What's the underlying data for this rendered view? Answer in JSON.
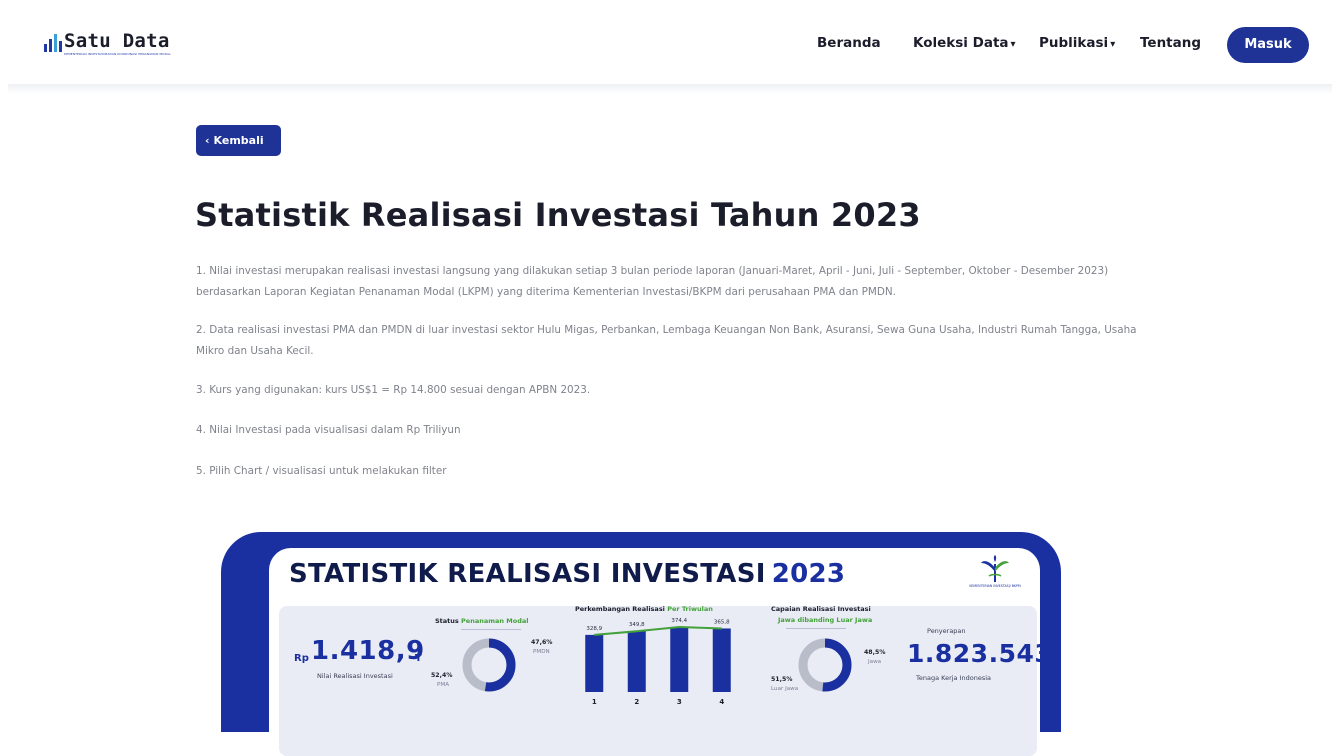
{
  "brand": {
    "name": "Satu Data",
    "subtitle": "KEMENTERIAN INVESTASI/BADAN KOORDINASI PENANAMAN MODAL"
  },
  "nav": {
    "items": [
      {
        "label": "Beranda"
      },
      {
        "label": "Koleksi Data",
        "chevron": "▾"
      },
      {
        "label": "Publikasi",
        "chevron": "▾"
      },
      {
        "label": "Tentang"
      }
    ],
    "login_label": "Masuk"
  },
  "back": {
    "icon": "‹",
    "label": "Kembali"
  },
  "page": {
    "title": "Statistik Realisasi Investasi Tahun 2023",
    "notes": [
      "1. Nilai investasi merupakan realisasi investasi langsung yang dilakukan setiap 3 bulan periode laporan (Januari-Maret, April - Juni, Juli - September, Oktober - Desember 2023) berdasarkan Laporan Kegiatan Penanaman Modal (LKPM) yang diterima Kementerian Investasi/BKPM dari perusahaan PMA dan PMDN.",
      "2. Data realisasi investasi PMA dan PMDN di luar investasi sektor Hulu Migas, Perbankan, Lembaga Keuangan Non Bank, Asuransi, Sewa Guna Usaha, Industri Rumah Tangga, Usaha Mikro dan Usaha Kecil.",
      "3. Kurs yang digunakan: kurs US$1 = Rp 14.800 sesuai dengan APBN 2023.",
      "4. Nilai Investasi pada visualisasi dalam Rp Triliyun",
      "5. Pilih Chart / visualisasi untuk melakukan filter"
    ]
  },
  "infographic": {
    "title_main": "STATISTIK REALISASI INVESTASI",
    "title_year": "2023",
    "logo_text": "KEMENTERIAN INVESTASI/ BKPM",
    "total": {
      "prefix": "Rp",
      "value": "1.418,9",
      "suffix": "T",
      "caption": "Nilai Realisasi Investasi"
    },
    "status": {
      "title_a": "Status",
      "title_b": "Penanaman Modal",
      "pma_pct": "52,4%",
      "pma_label": "PMA",
      "pmdn_pct": "47,6%",
      "pmdn_label": "PMDN"
    },
    "triwulan": {
      "title_a": "Perkembangan Realisasi",
      "title_b": "Per Triwulan"
    },
    "jawa": {
      "title_a": "Capaian Realisasi Investasi",
      "title_b": "Jawa dibanding Luar Jawa",
      "jawa_pct": "48,5%",
      "jawa_label": "Jawa",
      "luar_pct": "51,5%",
      "luar_label": "Luar Jawa"
    },
    "tenaga": {
      "title": "Penyerapan",
      "value": "1.823.543",
      "caption": "Tenaga Kerja Indonesia"
    },
    "colors": {
      "navy": "#1a2fa0",
      "green": "#44a13a",
      "grey": "#b8bdc9"
    }
  },
  "chart_data": [
    {
      "type": "bar",
      "title": "Perkembangan Realisasi Per Triwulan",
      "categories": [
        "1",
        "2",
        "3",
        "4"
      ],
      "values": [
        328.9,
        349.8,
        374.4,
        365.8
      ],
      "labels": [
        "328,9",
        "349,8",
        "374,4",
        "365,8"
      ],
      "ylim": [
        0,
        380
      ],
      "overlay": "line"
    },
    {
      "type": "pie",
      "title": "Status Penanaman Modal",
      "labels": [
        "PMA",
        "PMDN"
      ],
      "values": [
        52.4,
        47.6
      ],
      "style": "donut"
    },
    {
      "type": "pie",
      "title": "Capaian Realisasi Investasi Jawa dibanding Luar Jawa",
      "labels": [
        "Jawa",
        "Luar Jawa"
      ],
      "values": [
        48.5,
        51.5
      ],
      "style": "donut"
    }
  ]
}
